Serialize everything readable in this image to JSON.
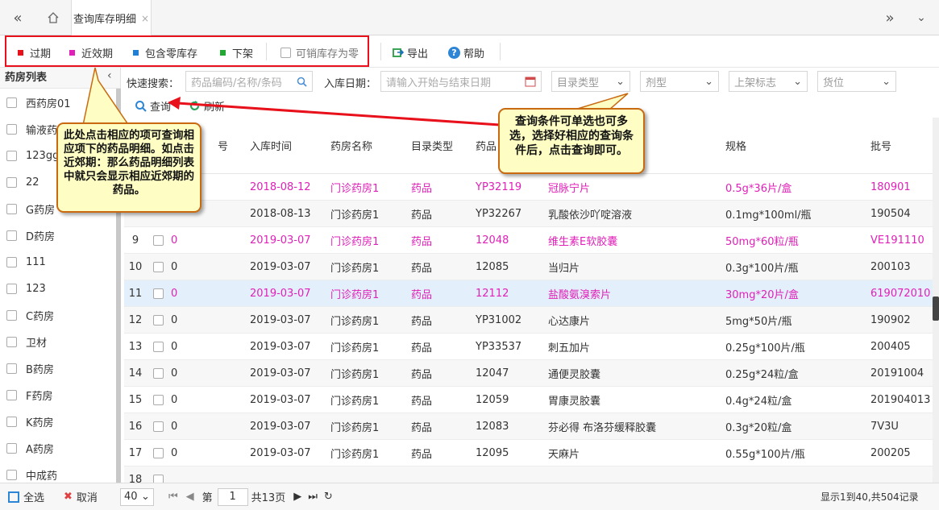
{
  "tabs": {
    "active": "查询库存明细",
    "close": "×"
  },
  "toolbar": {
    "legend": [
      {
        "label": "过期",
        "color": "#e8101a"
      },
      {
        "label": "近效期",
        "color": "#e020b8"
      },
      {
        "label": "包含零库存",
        "color": "#1f7fd6"
      },
      {
        "label": "下架",
        "color": "#22a832"
      }
    ],
    "zero_stock_check": "可销库存为零",
    "export": "导出",
    "help": "帮助"
  },
  "sidebar": {
    "title": "药房列表",
    "items": [
      "西药房01",
      "输液药",
      "123gg",
      "22",
      "G药房",
      "D药房",
      "111",
      "123",
      "C药房",
      "卫材",
      "B药房",
      "F药房",
      "K药房",
      "A药房",
      "中成药"
    ]
  },
  "filter": {
    "quick_label": "快速搜索：",
    "quick_placeholder": "药品编码/名称/条码",
    "date_label": "入库日期：",
    "date_placeholder": "请输入开始与结束日期",
    "catalog": "目录类型",
    "dosage": "剂型",
    "shelf": "上架标志",
    "location": "货位",
    "query": "查询",
    "refresh": "刷新"
  },
  "columns": {
    "qty": "号",
    "date": "入库时间",
    "pharmacy": "药房名称",
    "type": "目录类型",
    "code": "药品",
    "spec": "规格",
    "batch": "批号"
  },
  "rows": [
    {
      "n": "",
      "q": "",
      "d": "2018-08-12",
      "p": "门诊药房1",
      "t": "药品",
      "c": "YP32119",
      "m": "冠脉宁片",
      "s": "0.5g*36片/盒",
      "b": "180901",
      "color": "pink"
    },
    {
      "n": "",
      "q": "",
      "d": "2018-08-13",
      "p": "门诊药房1",
      "t": "药品",
      "c": "YP32267",
      "m": "乳酸依沙吖啶溶液",
      "s": "0.1mg*100ml/瓶",
      "b": "190504",
      "color": ""
    },
    {
      "n": "9",
      "q": "0",
      "d": "2019-03-07",
      "p": "门诊药房1",
      "t": "药品",
      "c": "12048",
      "m": "维生素E软胶囊",
      "s": "50mg*60粒/瓶",
      "b": "VE191110",
      "color": "pink"
    },
    {
      "n": "10",
      "q": "0",
      "d": "2019-03-07",
      "p": "门诊药房1",
      "t": "药品",
      "c": "12085",
      "m": "当归片",
      "s": "0.3g*100片/瓶",
      "b": "200103",
      "color": ""
    },
    {
      "n": "11",
      "q": "0",
      "d": "2019-03-07",
      "p": "门诊药房1",
      "t": "药品",
      "c": "12112",
      "m": "盐酸氨溴索片",
      "s": "30mg*20片/盒",
      "b": "619072010",
      "color": "pink"
    },
    {
      "n": "12",
      "q": "0",
      "d": "2019-03-07",
      "p": "门诊药房1",
      "t": "药品",
      "c": "YP31002",
      "m": "心达康片",
      "s": "5mg*50片/瓶",
      "b": "190902",
      "color": ""
    },
    {
      "n": "13",
      "q": "0",
      "d": "2019-03-07",
      "p": "门诊药房1",
      "t": "药品",
      "c": "YP33537",
      "m": "刺五加片",
      "s": "0.25g*100片/瓶",
      "b": "200405",
      "color": ""
    },
    {
      "n": "14",
      "q": "0",
      "d": "2019-03-07",
      "p": "门诊药房1",
      "t": "药品",
      "c": "12047",
      "m": "通便灵胶囊",
      "s": "0.25g*24粒/盒",
      "b": "20191004",
      "color": ""
    },
    {
      "n": "15",
      "q": "0",
      "d": "2019-03-07",
      "p": "门诊药房1",
      "t": "药品",
      "c": "12059",
      "m": "胃康灵胶囊",
      "s": "0.4g*24粒/盒",
      "b": "201904013",
      "color": ""
    },
    {
      "n": "16",
      "q": "0",
      "d": "2019-03-07",
      "p": "门诊药房1",
      "t": "药品",
      "c": "12083",
      "m": "芬必得 布洛芬缓释胶囊",
      "s": "0.3g*20粒/盒",
      "b": "7V3U",
      "color": ""
    },
    {
      "n": "17",
      "q": "0",
      "d": "2019-03-07",
      "p": "门诊药房1",
      "t": "药品",
      "c": "12095",
      "m": "天麻片",
      "s": "0.55g*100片/瓶",
      "b": "200205",
      "color": ""
    },
    {
      "n": "18",
      "q": "",
      "d": "",
      "p": "",
      "t": "",
      "c": "",
      "m": "",
      "s": "",
      "b": "",
      "color": ""
    }
  ],
  "footer": {
    "select_all": "全选",
    "cancel": "取消",
    "page_size": "40",
    "page_prefix": "第",
    "page": "1",
    "page_suffix": "共13页",
    "summary": "显示1到40,共504记录"
  },
  "callouts": {
    "left": "此处点击相应的项可查询相应项下的药品明细。如点击近郊期：那么药品明细列表中就只会显示相应近郊期的药品。",
    "right": "查询条件可单选也可多选，选择好相应的查询条件后，点击查询即可。"
  }
}
